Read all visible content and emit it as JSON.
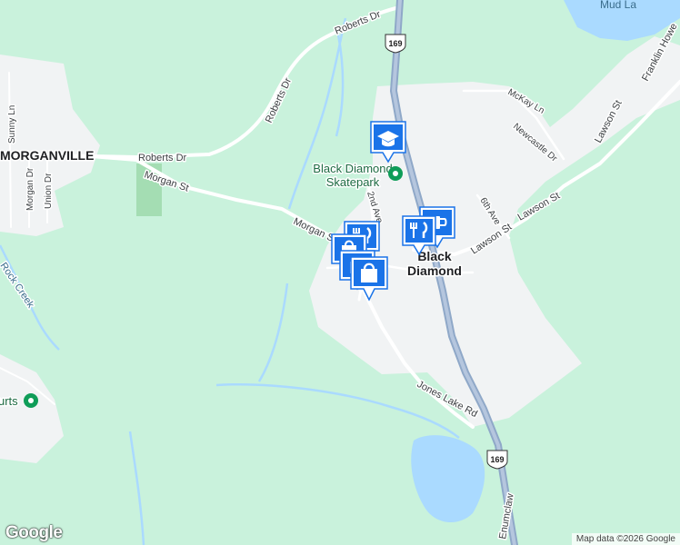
{
  "map": {
    "labels": {
      "morganville": "MORGANVILLE",
      "roberts_dr_top": "Roberts Dr",
      "roberts_dr_diag": "Roberts Dr",
      "roberts_dr_mid": "Roberts Dr",
      "morgan_st_west": "Morgan St",
      "morgan_st_east": "Morgan St",
      "sunny_ln": "Sunny Ln",
      "morgan_dr": "Morgan Dr",
      "union_dr": "Union Dr",
      "rock_creek": "Rock Creek",
      "mud_lake": "Mud La",
      "franklin_howe": "Franklin Howe",
      "lawson_st_ne": "Lawson St",
      "lawson_st_mid": "Lawson St",
      "lawson_st_town": "Lawson St",
      "mckay_ln": "McKay Ln",
      "newcastle_dr": "Newcastle Dr",
      "sixth_ave": "6th Ave",
      "second_ave": "2nd Ave",
      "jones_lake_rd": "Jones Lake Rd",
      "enumclaw": "Enumclaw",
      "town_line1": "Black",
      "town_line2": "Diamond",
      "skatepark_line1": "Black Diamond",
      "skatepark_line2": "Skatepark",
      "courts_partial": "urts"
    },
    "shields": {
      "route_top": "169",
      "route_bottom": "169"
    },
    "poi_icons": {
      "school": "graduation-cap-icon",
      "restaurant": "fork-knife-icon",
      "cafe": "coffee-cup-icon",
      "shopping": "shopping-bag-icon",
      "park": "park-marker-icon"
    },
    "colors": {
      "land": "#c9f2dc",
      "urban": "#f1f3f4",
      "road": "#ffffff",
      "highway": "#8fa8c8",
      "water": "#aadaff",
      "park_green": "#a4ddb3",
      "poi_blue": "#1a73e8",
      "park_pin": "#0f9d58"
    }
  },
  "footer": {
    "logo": "Google",
    "attribution": "Map data ©2026 Google"
  }
}
